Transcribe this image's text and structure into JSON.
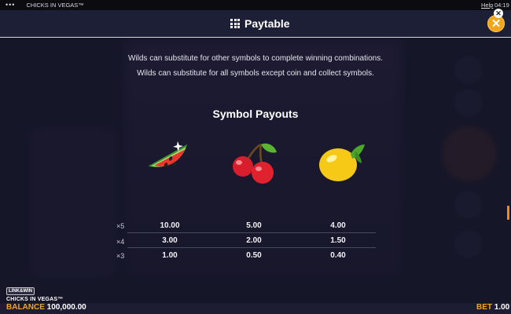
{
  "system_bar": {
    "menu_dots": "•••",
    "game_title": "CHICKS IN VEGAS™",
    "help_label": "Help",
    "clock": "04:19"
  },
  "header": {
    "title": "Paytable",
    "icon": "grid-icon",
    "close_icon": "close-icon",
    "close_glyph": "✕",
    "accent_color": "#f2a51a"
  },
  "rules": [
    "Wilds can substitute for other symbols to complete winning combinations.",
    "Wilds can substitute for all symbols except coin and collect symbols."
  ],
  "symbol_payouts": {
    "title": "Symbol Payouts",
    "multipliers": [
      "×5",
      "×4",
      "×3"
    ],
    "symbols": [
      {
        "icon": "watermelon-icon",
        "payouts": [
          "10.00",
          "3.00",
          "1.00"
        ]
      },
      {
        "icon": "cherries-icon",
        "payouts": [
          "5.00",
          "2.00",
          "0.50"
        ]
      },
      {
        "icon": "lemon-icon",
        "payouts": [
          "4.00",
          "1.50",
          "0.40"
        ]
      }
    ]
  },
  "footer": {
    "brand_badge": "LINK&WIN",
    "brand_game": "CHICKS IN VEGAS™",
    "balance_label": "BALANCE",
    "balance_value": "100,000.00",
    "bet_label": "BET",
    "bet_value": "1.00"
  }
}
